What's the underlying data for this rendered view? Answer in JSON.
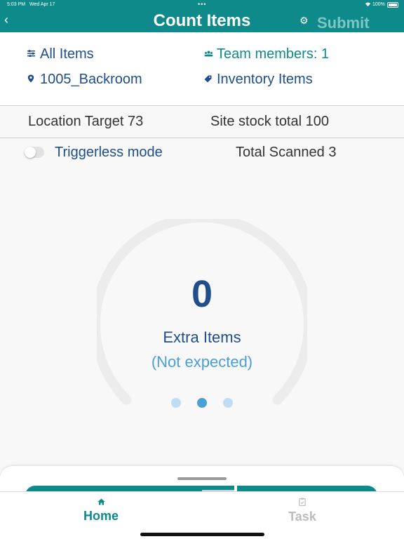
{
  "status_bar": {
    "time": "5:03 PM",
    "date": "Wed Apr 17",
    "battery": "100%"
  },
  "header": {
    "title": "Count Items",
    "submit_label": "Submit"
  },
  "filters": {
    "all_items": "All Items",
    "team_members": "Team members: 1",
    "location": "1005_Backroom",
    "inventory_items": "Inventory Items"
  },
  "stats": {
    "location_target": "Location Target 73",
    "site_stock_total": "Site stock total 100",
    "total_scanned": "Total Scanned 3"
  },
  "triggerless": {
    "label": "Triggerless mode",
    "enabled": false
  },
  "gauge": {
    "count": "0",
    "label": "Extra Items",
    "sublabel": "(Not expected)",
    "active_page": 2,
    "pages": 3
  },
  "tabs": [
    {
      "label": "Home",
      "icon": "home-icon",
      "active": true
    },
    {
      "label": "Task",
      "icon": "clipboard-icon",
      "active": false
    }
  ],
  "colors": {
    "teal": "#0f8a8a",
    "navy": "#1f4e8c",
    "light_blue": "#4a9fd6"
  }
}
